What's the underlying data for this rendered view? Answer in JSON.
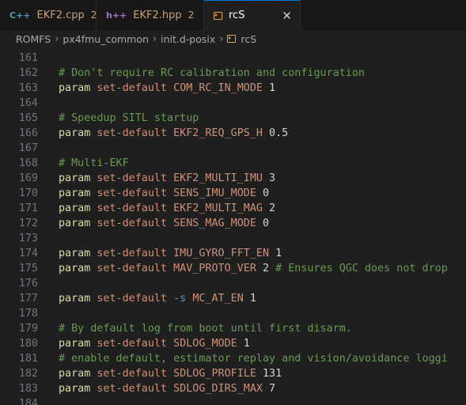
{
  "tabs": [
    {
      "icon": "C++",
      "label": "EKF2.cpp",
      "badge": "2"
    },
    {
      "icon": "h++",
      "label": "EKF2.hpp",
      "badge": "2"
    },
    {
      "label": "rcS",
      "close": "✕"
    }
  ],
  "breadcrumb": [
    "ROMFS",
    "px4fmu_common",
    "init.d-posix",
    "rcS"
  ],
  "breadcrumb_sep": "›",
  "lines": [
    {
      "n": "161",
      "segs": []
    },
    {
      "n": "162",
      "segs": [
        {
          "t": "# Don't require RC calibration and configuration",
          "c": "c-comment"
        }
      ]
    },
    {
      "n": "163",
      "segs": [
        {
          "t": "param",
          "c": "c-cmd"
        },
        {
          "t": " set-default ",
          "c": "c-arg"
        },
        {
          "t": "COM_RC_IN_MODE",
          "c": "c-arg"
        },
        {
          "t": " 1",
          "c": "c-var"
        }
      ]
    },
    {
      "n": "164",
      "segs": []
    },
    {
      "n": "165",
      "segs": [
        {
          "t": "# Speedup SITL startup",
          "c": "c-comment"
        }
      ]
    },
    {
      "n": "166",
      "segs": [
        {
          "t": "param",
          "c": "c-cmd"
        },
        {
          "t": " set-default ",
          "c": "c-arg"
        },
        {
          "t": "EKF2_REQ_GPS_H",
          "c": "c-arg"
        },
        {
          "t": " 0.5",
          "c": "c-var"
        }
      ]
    },
    {
      "n": "167",
      "segs": []
    },
    {
      "n": "168",
      "segs": [
        {
          "t": "# Multi-EKF",
          "c": "c-comment"
        }
      ]
    },
    {
      "n": "169",
      "segs": [
        {
          "t": "param",
          "c": "c-cmd"
        },
        {
          "t": " set-default ",
          "c": "c-arg"
        },
        {
          "t": "EKF2_MULTI_IMU",
          "c": "c-arg"
        },
        {
          "t": " 3",
          "c": "c-var"
        }
      ]
    },
    {
      "n": "170",
      "segs": [
        {
          "t": "param",
          "c": "c-cmd"
        },
        {
          "t": " set-default ",
          "c": "c-arg"
        },
        {
          "t": "SENS_IMU_MODE",
          "c": "c-arg"
        },
        {
          "t": " 0",
          "c": "c-var"
        }
      ]
    },
    {
      "n": "171",
      "segs": [
        {
          "t": "param",
          "c": "c-cmd"
        },
        {
          "t": " set-default ",
          "c": "c-arg"
        },
        {
          "t": "EKF2_MULTI_MAG",
          "c": "c-arg"
        },
        {
          "t": " 2",
          "c": "c-var"
        }
      ]
    },
    {
      "n": "172",
      "segs": [
        {
          "t": "param",
          "c": "c-cmd"
        },
        {
          "t": " set-default ",
          "c": "c-arg"
        },
        {
          "t": "SENS_MAG_MODE",
          "c": "c-arg"
        },
        {
          "t": " 0",
          "c": "c-var"
        }
      ]
    },
    {
      "n": "173",
      "segs": []
    },
    {
      "n": "174",
      "segs": [
        {
          "t": "param",
          "c": "c-cmd"
        },
        {
          "t": " set-default ",
          "c": "c-arg"
        },
        {
          "t": "IMU_GYRO_FFT_EN",
          "c": "c-arg"
        },
        {
          "t": " 1",
          "c": "c-var"
        }
      ]
    },
    {
      "n": "175",
      "segs": [
        {
          "t": "param",
          "c": "c-cmd"
        },
        {
          "t": " set-default ",
          "c": "c-arg"
        },
        {
          "t": "MAV_PROTO_VER",
          "c": "c-arg"
        },
        {
          "t": " 2 ",
          "c": "c-var"
        },
        {
          "t": "# Ensures QGC does not drop",
          "c": "c-comment"
        }
      ]
    },
    {
      "n": "176",
      "segs": []
    },
    {
      "n": "177",
      "segs": [
        {
          "t": "param",
          "c": "c-cmd"
        },
        {
          "t": " set-default ",
          "c": "c-arg"
        },
        {
          "t": "-s",
          "c": "c-flag"
        },
        {
          "t": " ",
          "c": "c-var"
        },
        {
          "t": "MC_AT_EN",
          "c": "c-arg"
        },
        {
          "t": " 1",
          "c": "c-var"
        }
      ]
    },
    {
      "n": "178",
      "segs": []
    },
    {
      "n": "179",
      "segs": [
        {
          "t": "# By default log from boot until first disarm.",
          "c": "c-comment"
        }
      ]
    },
    {
      "n": "180",
      "segs": [
        {
          "t": "param",
          "c": "c-cmd"
        },
        {
          "t": " set-default ",
          "c": "c-arg"
        },
        {
          "t": "SDLOG_MODE",
          "c": "c-arg"
        },
        {
          "t": " 1",
          "c": "c-var"
        }
      ]
    },
    {
      "n": "181",
      "segs": [
        {
          "t": "# enable default, estimator replay and vision/avoidance loggi",
          "c": "c-comment"
        }
      ]
    },
    {
      "n": "182",
      "segs": [
        {
          "t": "param",
          "c": "c-cmd"
        },
        {
          "t": " set-default ",
          "c": "c-arg"
        },
        {
          "t": "SDLOG_PROFILE",
          "c": "c-arg"
        },
        {
          "t": " 131",
          "c": "c-var"
        }
      ]
    },
    {
      "n": "183",
      "segs": [
        {
          "t": "param",
          "c": "c-cmd"
        },
        {
          "t": " set-default ",
          "c": "c-arg"
        },
        {
          "t": "SDLOG_DIRS_MAX",
          "c": "c-arg"
        },
        {
          "t": " 7",
          "c": "c-var"
        }
      ]
    },
    {
      "n": "184",
      "segs": []
    }
  ]
}
